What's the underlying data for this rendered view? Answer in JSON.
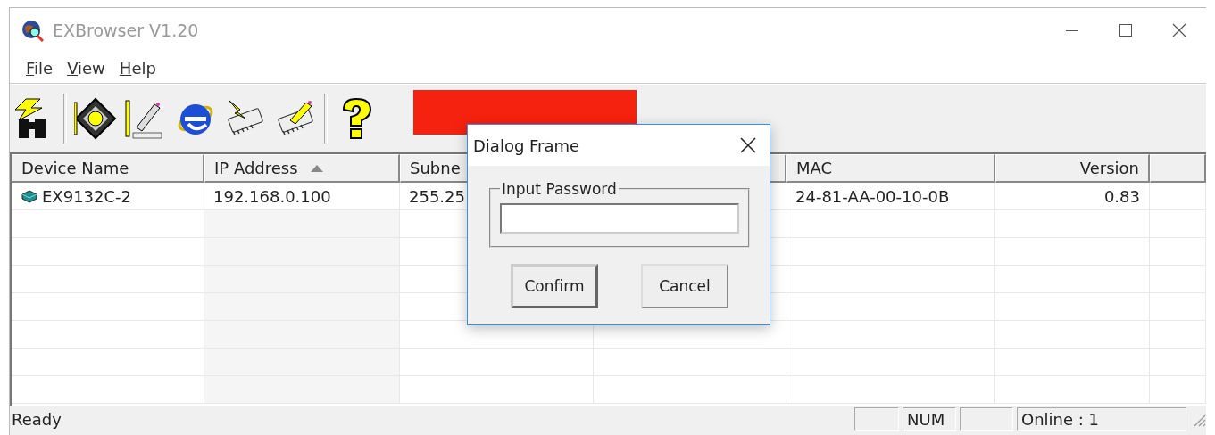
{
  "window": {
    "title": "EXBrowser V1.20"
  },
  "menu": [
    {
      "label": "File"
    },
    {
      "label": "View"
    },
    {
      "label": "Help"
    }
  ],
  "table": {
    "columns": [
      {
        "label": "Device Name",
        "right_aligned": false,
        "sorted": false
      },
      {
        "label": "IP Address",
        "right_aligned": false,
        "sorted": true
      },
      {
        "label": "Subne",
        "right_aligned": false,
        "sorted": false
      },
      {
        "sorted": false
      },
      {
        "label": "MAC",
        "right_aligned": false,
        "sorted": false
      },
      {
        "label": "Version",
        "right_aligned": true,
        "sorted": false
      }
    ],
    "rows": [
      {
        "cells": [
          "EX9132C-2",
          "192.168.0.100",
          "255.25",
          null,
          "24-81-AA-00-10-0B",
          "0.83"
        ]
      }
    ]
  },
  "dialog": {
    "title": "Dialog Frame",
    "group_label": "Input Password",
    "buttons": [
      {
        "label": "Confirm",
        "default": true
      },
      {
        "label": "Cancel",
        "default": false
      }
    ]
  },
  "status_bar": {
    "message": "Ready",
    "panes": [
      {
        "kind": "empty"
      },
      {
        "kind": "text",
        "text": "NUM"
      },
      {
        "kind": "empty"
      },
      {
        "kind": "text",
        "text": "Online : 1"
      }
    ]
  }
}
